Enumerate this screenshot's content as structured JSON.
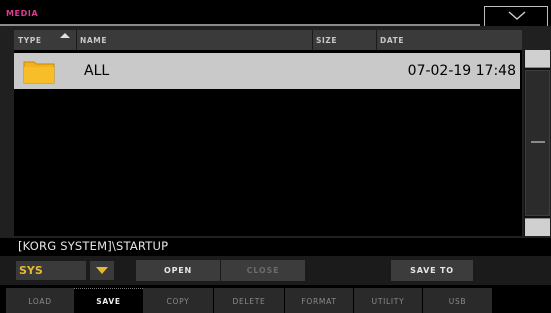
{
  "window": {
    "title": "MEDIA"
  },
  "columns": {
    "type": "TYPE",
    "name": "NAME",
    "size": "SIZE",
    "date": "DATE"
  },
  "files": [
    {
      "icon": "folder-icon",
      "name": "ALL",
      "size": "",
      "date": "07-02-19 17:48",
      "selected": true
    }
  ],
  "path": "[KORG SYSTEM]\\STARTUP",
  "device": {
    "selected": "SYS"
  },
  "buttons": {
    "open": "OPEN",
    "close": "CLOSE",
    "save_to": "SAVE TO"
  },
  "tabs": [
    {
      "label": "LOAD",
      "active": false
    },
    {
      "label": "SAVE",
      "active": true
    },
    {
      "label": "COPY",
      "active": false
    },
    {
      "label": "DELETE",
      "active": false
    },
    {
      "label": "FORMAT",
      "active": false
    },
    {
      "label": "UTILITY",
      "active": false
    },
    {
      "label": "USB",
      "active": false
    }
  ],
  "colors": {
    "title": "#d93c8f",
    "device_accent": "#e7b92e",
    "selected_row": "#c9c9c9",
    "folder": "#f5b21a"
  }
}
